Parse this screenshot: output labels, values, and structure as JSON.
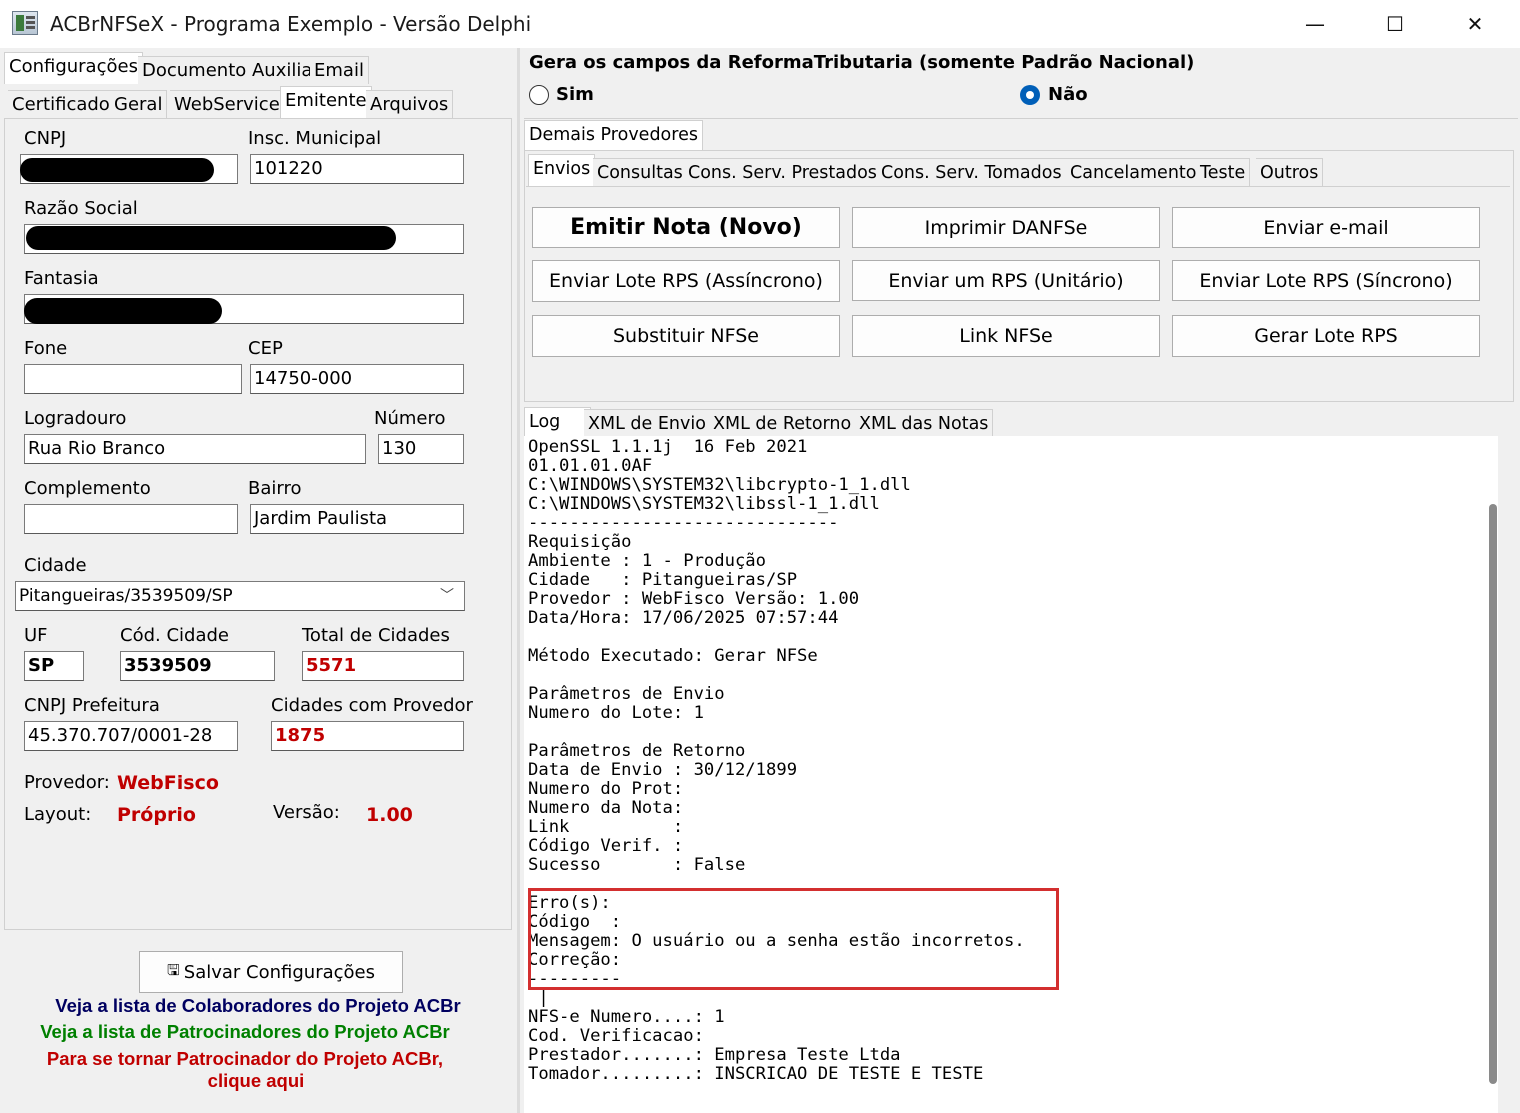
{
  "window": {
    "title": "ACBrNFSeX - Programa Exemplo - Versão Delphi",
    "minimize": "—",
    "maximize": "☐",
    "close": "✕"
  },
  "left": {
    "tabs_top": [
      "Configurações",
      "Documento Auxiliar",
      "Email"
    ],
    "tabs_sub": [
      "Certificado",
      "Geral",
      "WebService",
      "Emitente",
      "Arquivos"
    ],
    "labels": {
      "cnpj": "CNPJ",
      "insc_municipal": "Insc. Municipal",
      "razao_social": "Razão Social",
      "fantasia": "Fantasia",
      "fone": "Fone",
      "cep": "CEP",
      "logradouro": "Logradouro",
      "numero": "Número",
      "complemento": "Complemento",
      "bairro": "Bairro",
      "cidade": "Cidade",
      "uf": "UF",
      "cod_cidade": "Cód. Cidade",
      "total_cidades": "Total de Cidades",
      "cnpj_prefeitura": "CNPJ Prefeitura",
      "cidades_provedor": "Cidades com Provedor",
      "provedor": "Provedor:",
      "layout": "Layout:",
      "versao": "Versão:"
    },
    "values": {
      "insc_municipal": "101220",
      "cep": "14750-000",
      "logradouro": "Rua Rio Branco",
      "numero": "130",
      "bairro": "Jardim Paulista",
      "cidade": "Pitangueiras/3539509/SP",
      "uf": "SP",
      "cod_cidade": "3539509",
      "total_cidades": "5571",
      "cnpj_prefeitura": "45.370.707/0001-28",
      "cidades_provedor": "1875",
      "provedor": "WebFisco",
      "layout": "Próprio",
      "versao": "1.00"
    },
    "save_button": "Salvar Configurações",
    "links": {
      "colaboradores": "Veja a lista de Colaboradores do Projeto ACBr",
      "patrocinadores": "Veja a lista de Patrocinadores do Projeto ACBr",
      "tornar_line1": "Para se tornar Patrocinador do Projeto ACBr,",
      "tornar_line2": "clique aqui"
    }
  },
  "right": {
    "reforma_title": "Gera os campos da ReformaTributaria (somente Padrão Nacional)",
    "radio_sim": "Sim",
    "radio_nao": "Não",
    "group_tab": "Demais Provedores",
    "tabs": [
      "Envios",
      "Consultas",
      "Cons. Serv. Prestados",
      "Cons. Serv. Tomados",
      "Cancelamento",
      "Teste",
      "Outros"
    ],
    "buttons": [
      "Emitir Nota (Novo)",
      "Imprimir DANFSe",
      "Enviar e-mail",
      "Enviar Lote RPS (Assíncrono)",
      "Enviar um RPS (Unitário)",
      "Enviar Lote RPS (Síncrono)",
      "Substituir NFSe",
      "Link NFSe",
      "Gerar Lote RPS"
    ],
    "log_tabs": [
      "Log",
      "XML de Envio",
      "XML de Retorno",
      "XML das Notas"
    ],
    "log_text": "OpenSSL 1.1.1j  16 Feb 2021\n01.01.01.0AF\nC:\\WINDOWS\\SYSTEM32\\libcrypto-1_1.dll\nC:\\WINDOWS\\SYSTEM32\\libssl-1_1.dll\n------------------------------\nRequisição\nAmbiente : 1 - Produção\nCidade   : Pitangueiras/SP\nProvedor : WebFisco Versão: 1.00\nData/Hora: 17/06/2025 07:57:44\n\nMétodo Executado: Gerar NFSe\n\nParâmetros de Envio\nNumero do Lote: 1\n\nParâmetros de Retorno\nData de Envio : 30/12/1899\nNumero do Prot:\nNumero da Nota:\nLink          :\nCódigo Verif. :\nSucesso       : False\n\nErro(s):\nCódigo  :\nMensagem: O usuário ou a senha estão incorretos.\nCorreção:\n---------\n |\nNFS-e Numero....: 1\nCod. Verificacao:\nPrestador.......: Empresa Teste Ltda\nTomador.........: INSCRICAO DE TESTE E TESTE"
  },
  "colors": {
    "red": "#c00000",
    "navy": "#000060",
    "green": "#008000",
    "highlight": "#d32f2f",
    "radio_accent": "#005fb8"
  }
}
